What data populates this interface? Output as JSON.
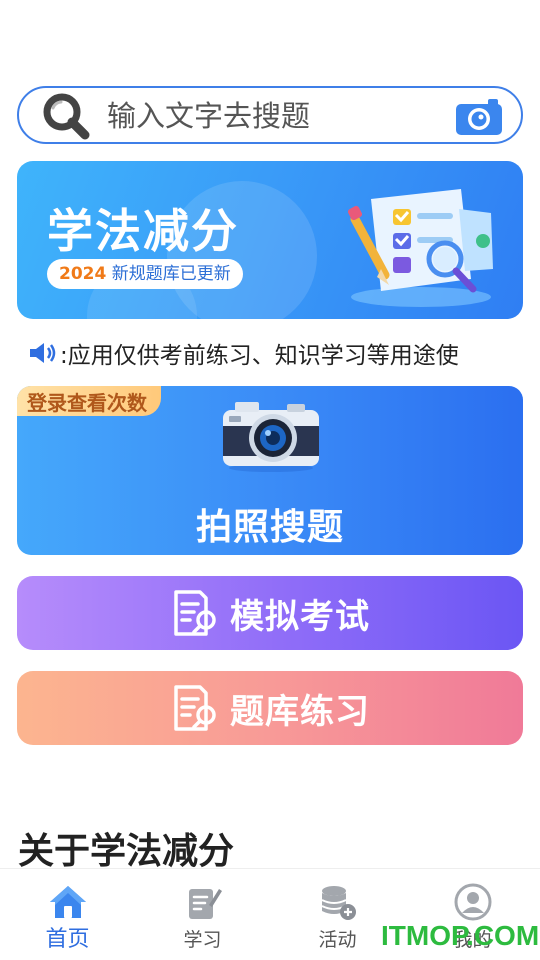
{
  "search": {
    "placeholder": "输入文字去搜题",
    "icon": "search-icon",
    "camera_icon": "camera-icon"
  },
  "banner": {
    "title": "学法减分",
    "subtitle_year": "2024",
    "subtitle_text": " 新规题库已更新"
  },
  "notice": {
    "icon": "speaker-icon",
    "text": ":应用仅供考前练习、知识学习等用途使"
  },
  "photo_search": {
    "badge": "登录查看次数",
    "label": "拍照搜题"
  },
  "actions": {
    "exam_label": "模拟考试",
    "bank_label": "题库练习"
  },
  "about": {
    "heading": "关于学法减分"
  },
  "tabbar": {
    "items": [
      {
        "label": "首页",
        "icon": "home-icon",
        "active": true
      },
      {
        "label": "学习",
        "icon": "study-icon",
        "active": false
      },
      {
        "label": "活动",
        "icon": "activity-icon",
        "active": false
      },
      {
        "label": "我的",
        "icon": "profile-icon",
        "active": false
      }
    ]
  },
  "watermark": "ITMOP.COM",
  "colors": {
    "accent": "#2f6ee0",
    "exam_gradient": [
      "#b68cfb",
      "#6b56f4"
    ],
    "bank_gradient": [
      "#fcb58f",
      "#f07a98"
    ],
    "badge_text": "#b0581b"
  }
}
